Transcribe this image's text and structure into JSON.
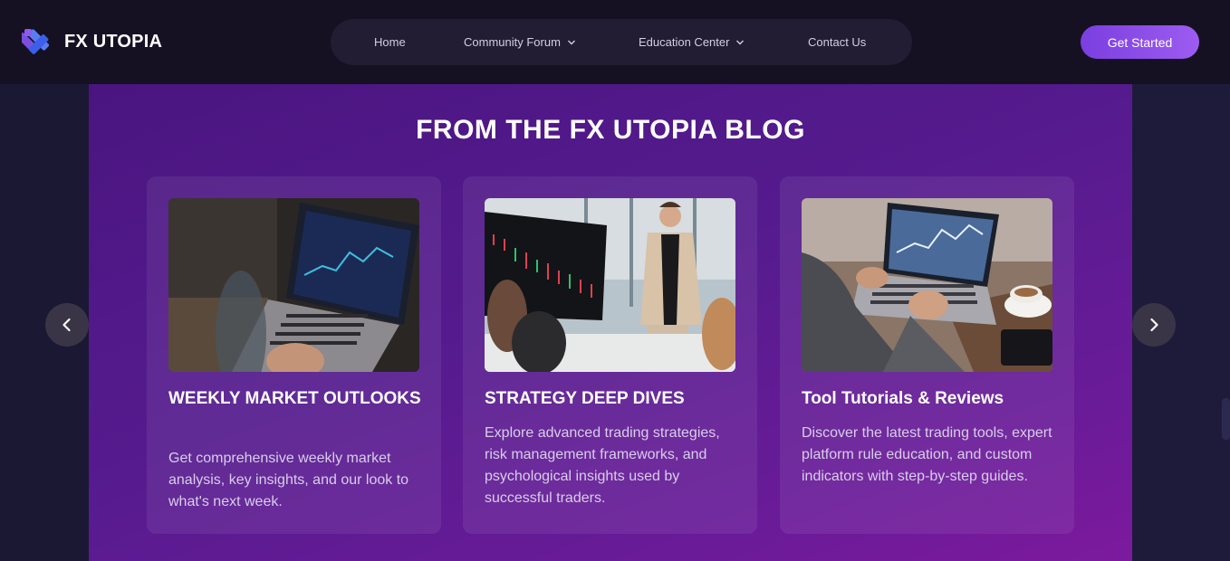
{
  "header": {
    "brand": "FX UTOPIA",
    "nav": [
      {
        "label": "Home",
        "has_dropdown": false
      },
      {
        "label": "Community Forum",
        "has_dropdown": true
      },
      {
        "label": "Education Center",
        "has_dropdown": true
      },
      {
        "label": "Contact Us",
        "has_dropdown": false
      }
    ],
    "cta_label": "Get Started"
  },
  "blog": {
    "title": "FROM THE FX UTOPIA BLOG",
    "cards": [
      {
        "title": "WEEKLY MARKET OUTLOOKS",
        "body": "Get comprehensive weekly market analysis, key insights, and our look to what's next week.",
        "image": "laptop-trading-chart-photo"
      },
      {
        "title": "STRATEGY DEEP DIVES",
        "body": "Explore advanced trading strategies, risk management frameworks, and psychological insights used by successful traders.",
        "image": "presenter-with-trading-screen-photo"
      },
      {
        "title": "Tool Tutorials & Reviews",
        "body": "Discover the latest trading tools, expert platform rule education, and custom indicators with step-by-step guides.",
        "image": "hands-on-laptop-with-coffee-photo"
      }
    ]
  },
  "icons": {
    "logo": "fx-utopia-logo-icon",
    "prev": "chevron-left-icon",
    "next": "chevron-right-icon",
    "dropdown": "chevron-down-icon"
  },
  "colors": {
    "accent": "#8b4ae8",
    "header_bg": "#151122",
    "blog_bg": "#551b8e"
  }
}
